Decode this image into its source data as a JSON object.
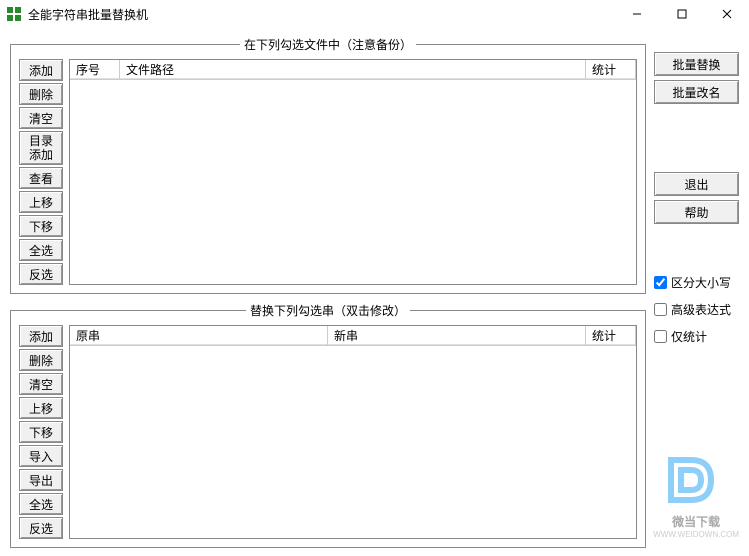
{
  "window": {
    "title": "全能字符串批量替换机"
  },
  "panelTop": {
    "legend": "在下列勾选文件中（注意备份）",
    "buttons": {
      "add": "添加",
      "delete": "删除",
      "clear": "清空",
      "addDir": "目录\n添加",
      "view": "查看",
      "moveUp": "上移",
      "moveDown": "下移",
      "selectAll": "全选",
      "invert": "反选"
    },
    "columns": {
      "index": "序号",
      "path": "文件路径",
      "stat": "统计"
    }
  },
  "panelBottom": {
    "legend": "替换下列勾选串（双击修改）",
    "buttons": {
      "add": "添加",
      "delete": "删除",
      "clear": "清空",
      "moveUp": "上移",
      "moveDown": "下移",
      "import": "导入",
      "export": "导出",
      "selectAll": "全选",
      "invert": "反选"
    },
    "columns": {
      "orig": "原串",
      "new": "新串",
      "stat": "统计"
    }
  },
  "right": {
    "batchReplace": "批量替换",
    "batchRename": "批量改名",
    "exit": "退出",
    "help": "帮助",
    "caseSensitive": "区分大小写",
    "advancedExpr": "高级表达式",
    "statOnly": "仅统计",
    "caseSensitiveChecked": true,
    "advancedExprChecked": false,
    "statOnlyChecked": false
  },
  "watermark": {
    "text1": "微当下载",
    "text2": "WWW.WEIDOWN.COM"
  }
}
